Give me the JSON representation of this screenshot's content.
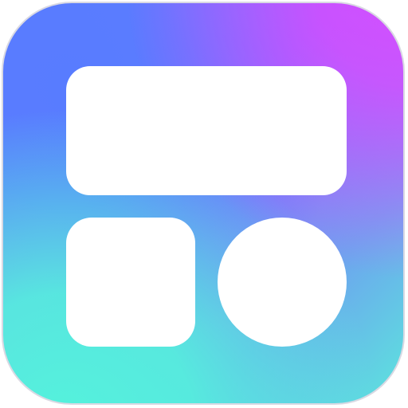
{
  "icon": {
    "semantic": "widget-layout-icon",
    "colors": {
      "primary_blue": "#587cff",
      "accent_pink": "#d64dff",
      "accent_teal": "#54f2dc",
      "tile_white": "#ffffff"
    }
  }
}
